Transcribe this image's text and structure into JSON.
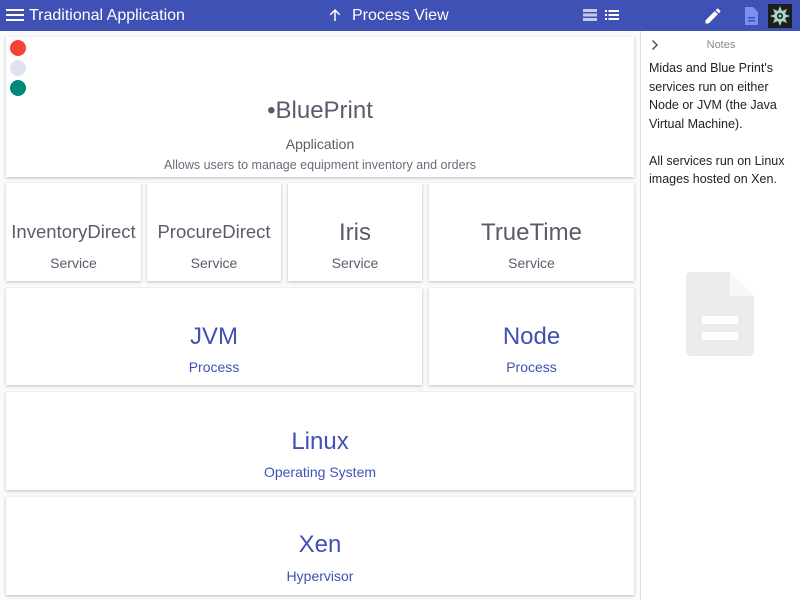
{
  "header": {
    "app_title": "Traditional Application",
    "view_title": "Process View"
  },
  "legend_dots": {
    "colors": [
      "#f44336",
      "#dfe3ef",
      "#00897b"
    ]
  },
  "application": {
    "bullet": "•",
    "name": "BluePrint",
    "kind": "Application",
    "description": "Allows users to manage equipment inventory and orders"
  },
  "services": [
    {
      "name": "InventoryDirect",
      "kind": "Service"
    },
    {
      "name": "ProcureDirect",
      "kind": "Service"
    },
    {
      "name": "Iris",
      "kind": "Service"
    },
    {
      "name": "TrueTime",
      "kind": "Service"
    }
  ],
  "processes": [
    {
      "name": "JVM",
      "kind": "Process"
    },
    {
      "name": "Node",
      "kind": "Process"
    }
  ],
  "operating_system": {
    "name": "Linux",
    "kind": "Operating System"
  },
  "hypervisor": {
    "name": "Xen",
    "kind": "Hypervisor"
  },
  "notes": {
    "title": "Notes",
    "text": "Midas and Blue Print's services run on either Node or JVM (the Java Virtual Machine).\n\nAll services run on Linux images hosted on Xen."
  },
  "colors": {
    "primary": "#3f51b5",
    "gray_text": "#5b5b6b"
  }
}
